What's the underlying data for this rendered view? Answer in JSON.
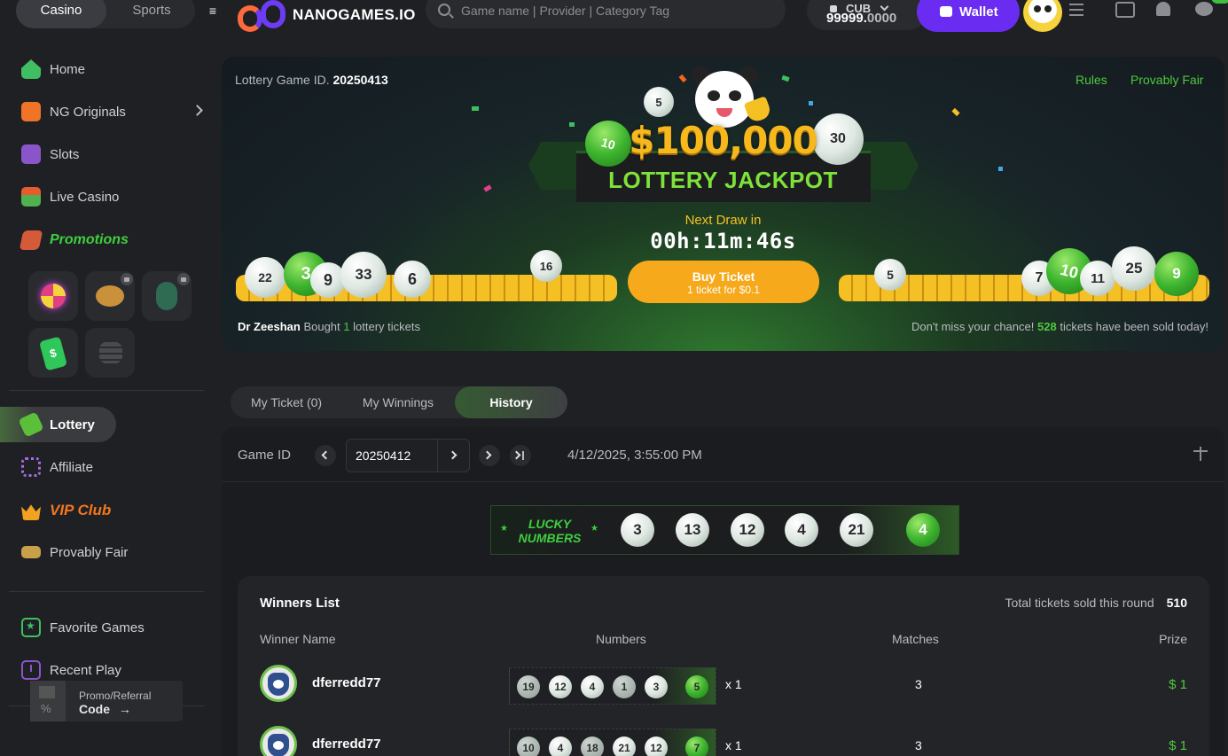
{
  "topbar": {
    "tabs": {
      "casino": "Casino",
      "sports": "Sports"
    },
    "menu_glyph": "≡",
    "logo_text": "NANOGAMES.IO",
    "search_placeholder": "Game name | Provider | Category Tag",
    "currency": "CUB",
    "balance_int": "99999.",
    "balance_dec": "0000",
    "wallet_label": "Wallet"
  },
  "sidebar": {
    "home": "Home",
    "originals": "NG Originals",
    "slots": "Slots",
    "live_casino": "Live Casino",
    "promotions": "Promotions",
    "tag_glyph": "$",
    "lottery": "Lottery",
    "affiliate": "Affiliate",
    "vip_club": "VIP Club",
    "provably_fair": "Provably Fair",
    "favorite_games": "Favorite Games",
    "recent_play": "Recent Play",
    "promo_line1": "Promo/Referral",
    "promo_line2": "Code",
    "promo_arrow": "→",
    "promo_pct": "%"
  },
  "banner": {
    "game_id_label": "Lottery Game ID.",
    "game_id": "20250413",
    "rules": "Rules",
    "provably_fair": "Provably Fair",
    "jackpot_amount": "$100,000",
    "jackpot_title": "LOTTERY JACKPOT",
    "next_draw_label": "Next Draw in",
    "countdown": "00h:11m:46s",
    "buy_label": "Buy Ticket",
    "buy_sub": "1 ticket for $0.1",
    "ticker_user": "Dr Zeeshan",
    "ticker_bought": "Bought",
    "ticker_count": "1",
    "ticker_suffix": "lottery tickets",
    "sold_prefix": "Don't miss your chance!",
    "sold_count": "528",
    "sold_suffix": "tickets have been sold today!",
    "balls_top": [
      "5",
      "10",
      "30"
    ],
    "balls_left": [
      "22",
      "3",
      "9",
      "33",
      "6",
      "16"
    ],
    "balls_right": [
      "5",
      "7",
      "10",
      "11",
      "25",
      "9"
    ]
  },
  "tabs": {
    "my_ticket": "My Ticket (0)",
    "my_winnings": "My Winnings",
    "history": "History"
  },
  "history": {
    "game_id_label": "Game ID",
    "game_id_value": "20250412",
    "datetime": "4/12/2025, 3:55:00 PM",
    "lucky_line1": "LUCKY",
    "lucky_line2": "NUMBERS",
    "star_glyph": "★",
    "lucky_numbers": [
      "3",
      "13",
      "12",
      "4",
      "21"
    ],
    "lucky_special": "4"
  },
  "winners": {
    "title": "Winners List",
    "total_label": "Total tickets sold this round",
    "total_value": "510",
    "col_name": "Winner Name",
    "col_numbers": "Numbers",
    "col_matches": "Matches",
    "col_prize": "Prize",
    "rows": [
      {
        "name": "dferredd77",
        "numbers": [
          "19",
          "12",
          "4",
          "1",
          "3"
        ],
        "special": "5",
        "multiplier": "x 1",
        "matches": "3",
        "prize": "$ 1"
      },
      {
        "name": "dferredd77",
        "numbers": [
          "10",
          "4",
          "18",
          "21",
          "12"
        ],
        "special": "7",
        "multiplier": "x 1",
        "matches": "3",
        "prize": "$ 1"
      }
    ]
  },
  "colors": {
    "accent_green": "#4fc83c",
    "wallet_purple": "#6a2cf0",
    "gold": "#f5a91b",
    "background": "#1f2023"
  }
}
